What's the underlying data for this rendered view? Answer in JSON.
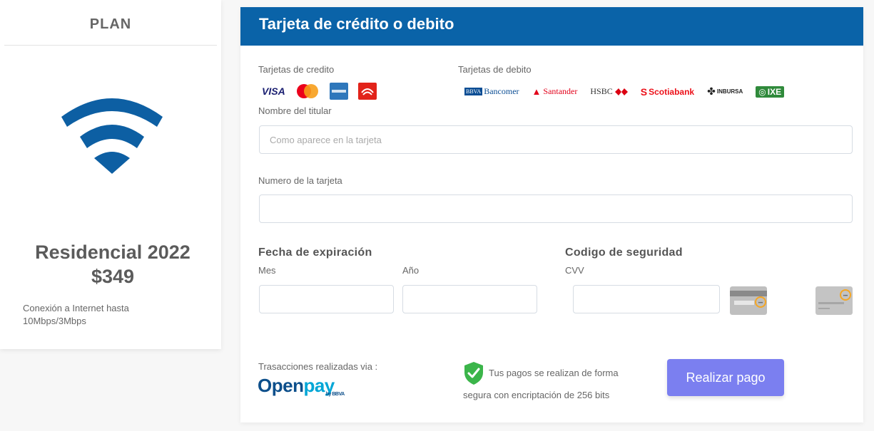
{
  "plan": {
    "header": "PLAN",
    "name": "Residencial 2022",
    "price": "$349",
    "description": "Conexión a Internet hasta 10Mbps/3Mbps"
  },
  "payment": {
    "title": "Tarjeta de crédito o debito",
    "credit_label": "Tarjetas de credito",
    "debit_label": "Tarjetas de debito",
    "credit_logos": [
      "VISA",
      "MasterCard",
      "AMEX",
      "Carnet"
    ],
    "debit_logos": [
      "Bancomer",
      "Santander",
      "HSBC",
      "Scotiabank",
      "INBURSA",
      "IXE"
    ],
    "holder_label": "Nombre del titular",
    "holder_placeholder": "Como aparece en la tarjeta",
    "card_number_label": "Numero de la tarjeta",
    "card_number_value": "",
    "expiration_label": "Fecha de expiración",
    "month_label": "Mes",
    "year_label": "Año",
    "security_label": "Codigo de seguridad",
    "cvv_label": "CVV",
    "via_label": "Trasacciones realizadas via :",
    "openpay_logo": "Openpay",
    "secure_line1": "Tus pagos se realizan de forma",
    "secure_line2": "segura con encriptación de 256 bits",
    "submit_label": "Realizar pago",
    "colors": {
      "header": "#0a63a8",
      "button": "#7b7ff0",
      "wifi": "#0d5fa3",
      "shield": "#3bb54a"
    }
  }
}
